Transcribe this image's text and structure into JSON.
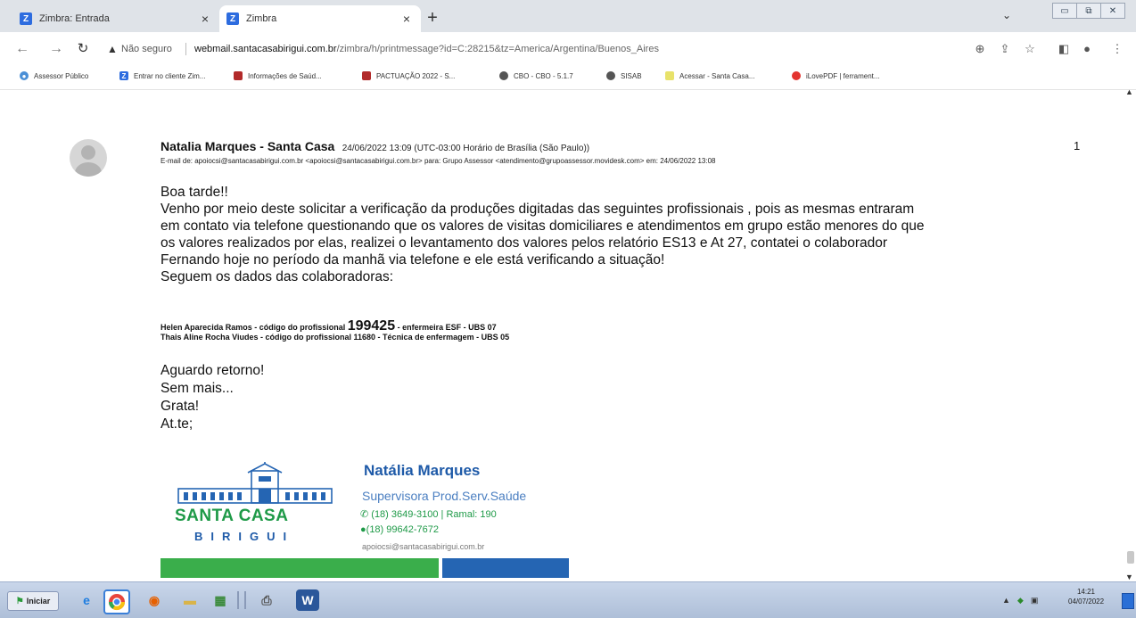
{
  "browser": {
    "tabs": [
      {
        "label": "Zimbra: Entrada",
        "favicon": "Z"
      },
      {
        "label": "Zimbra",
        "favicon": "Z"
      }
    ],
    "security_label": "Não seguro",
    "url_host": "webmail.santacasabirigui.com.br",
    "url_path": "/zimbra/h/printmessage?id=C:28215&tz=America/Argentina/Buenos_Aires",
    "bookmarks": [
      "Assessor Público",
      "Entrar no cliente Zim...",
      "Informações de Saúd...",
      "PACTUAÇÃO 2022 - S...",
      "CBO - CBO - 5.1.7",
      "SISAB",
      "Acessar - Santa Casa...",
      "iLovePDF | ferrament..."
    ]
  },
  "message": {
    "sender": "Natalia Marques - Santa Casa",
    "sent_date": "24/06/2022 13:09 (UTC-03:00 Horário de Brasília (São Paulo))",
    "meta": "E-mail de: apoiocsi@santacasabirigui.com.br <apoiocsi@santacasabirigui.com.br> para: Grupo Assessor <atendimento@grupoassessor.movidesk.com> em: 24/06/2022 13:08",
    "count": "1",
    "body_lines": [
      "Boa tarde!!",
      "Venho por meio deste solicitar a verificação da produções digitadas das seguintes profissionais , pois as mesmas entraram",
      "em contato via telefone questionando que os valores de visitas domiciliares e atendimentos em grupo estão menores do que",
      "os valores realizados por elas, realizei o levantamento dos valores pelos relatório ES13 e At 27, contatei o colaborador",
      "Fernando hoje no período da manhã via telefone e ele está verificando a situação!",
      "Seguem os dados das colaboradoras:"
    ],
    "collaborator_1_prefix": "Helen Aparecida Ramos - código do profissional ",
    "collaborator_1_code": "199425",
    "collaborator_1_suffix": " - enfermeira ESF - UBS 07",
    "collaborator_2": "Thais Aline Rocha Viudes - código do profissional 11680 - Técnica de enfermagem - UBS 05",
    "closing_lines": [
      "Aguardo retorno!",
      "Sem mais...",
      "Grata!",
      "At.te;"
    ]
  },
  "signature": {
    "brand_line1": "SANTA CASA",
    "brand_line2": "BIRIGUI",
    "name": "Natália Marques",
    "role": "Supervisora Prod.Serv.Saúde",
    "phone": "(18) 3649-3100 | Ramal: 190",
    "whatsapp": "(18) 99642-7672",
    "email": "apoiocsi@santacasabirigui.com.br"
  },
  "taskbar": {
    "start_label": "Iniciar",
    "time": "14:21",
    "date": "04/07/2022"
  }
}
